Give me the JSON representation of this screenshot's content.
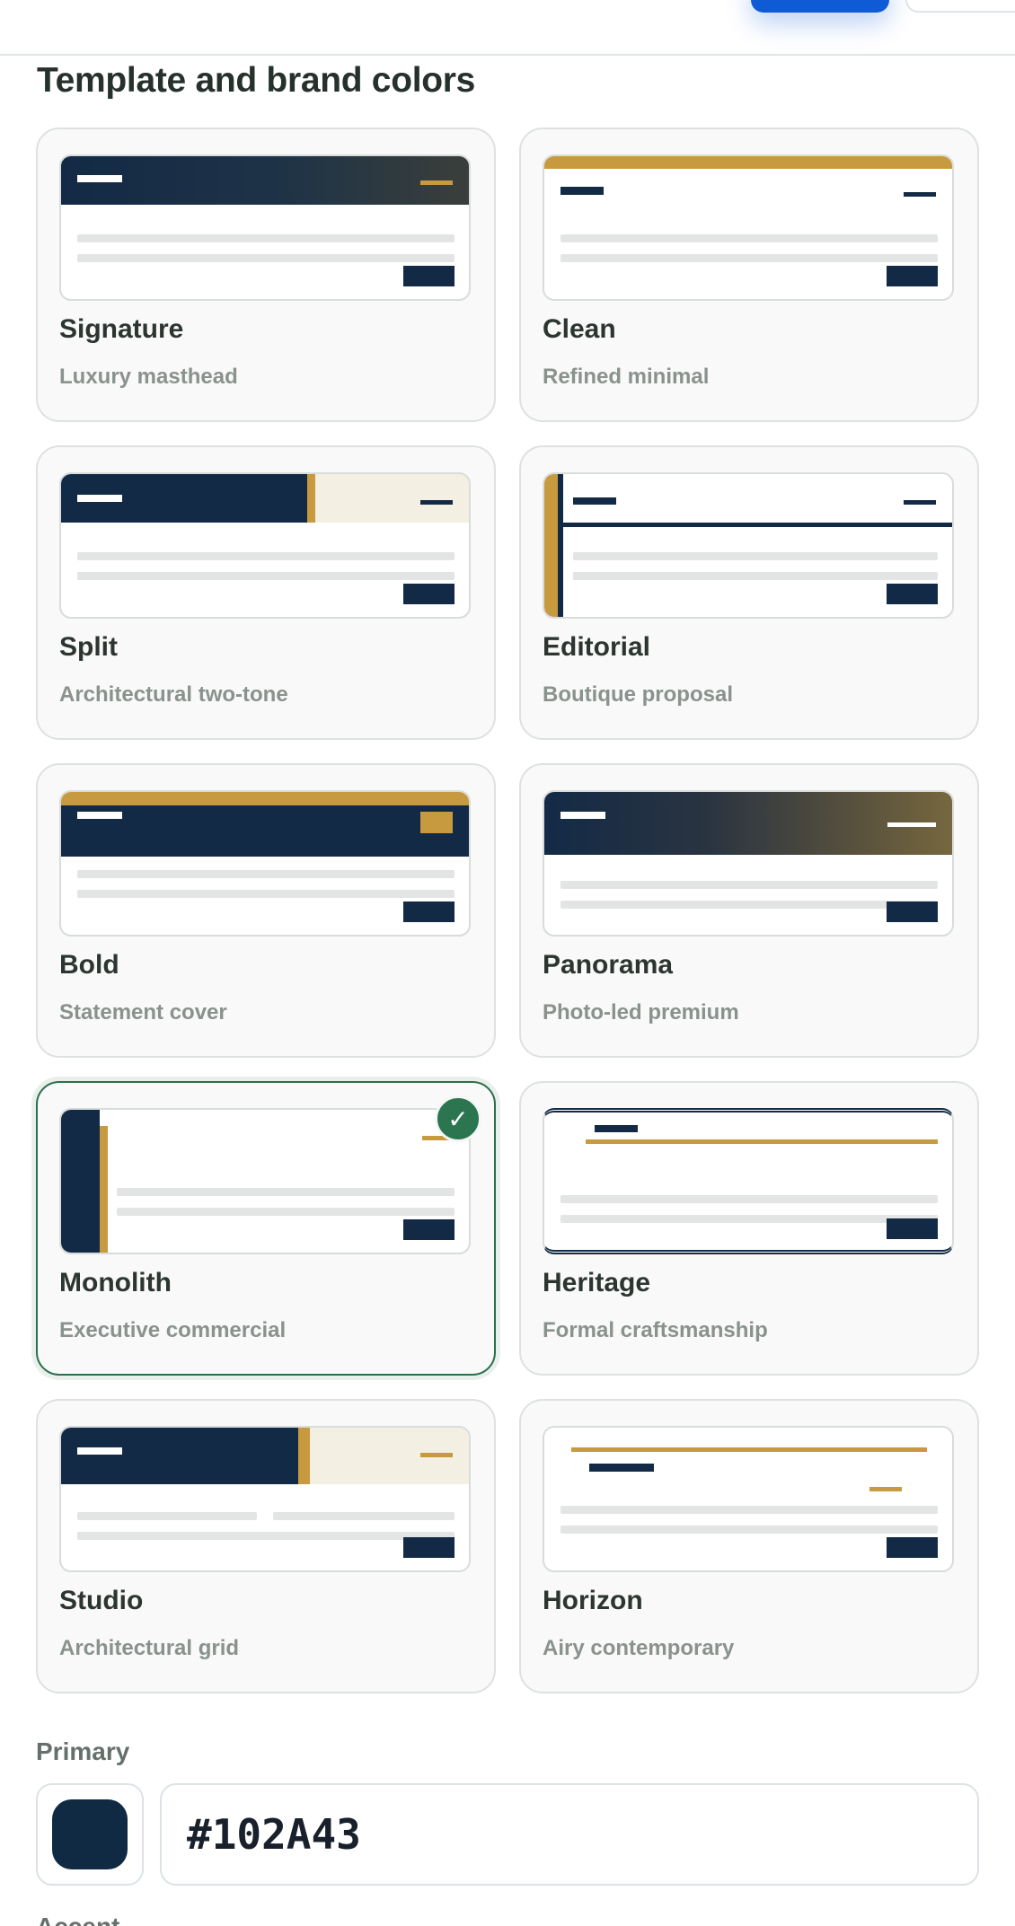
{
  "section": {
    "title": "Template and brand colors"
  },
  "templates": [
    {
      "name": "Signature",
      "desc": "Luxury masthead"
    },
    {
      "name": "Clean",
      "desc": "Refined minimal"
    },
    {
      "name": "Split",
      "desc": "Architectural two-tone"
    },
    {
      "name": "Editorial",
      "desc": "Boutique proposal"
    },
    {
      "name": "Bold",
      "desc": "Statement cover"
    },
    {
      "name": "Panorama",
      "desc": "Photo-led premium"
    },
    {
      "name": "Monolith",
      "desc": "Executive commercial"
    },
    {
      "name": "Heritage",
      "desc": "Formal craftsmanship"
    },
    {
      "name": "Studio",
      "desc": "Architectural grid"
    },
    {
      "name": "Horizon",
      "desc": "Airy contemporary"
    }
  ],
  "selected_template": "Monolith",
  "selected_check_icon": "✓",
  "colors": {
    "primary_label": "Primary",
    "primary_value": "#102A43",
    "next_label": "Accent",
    "navy": "#132A46",
    "gold": "#C89A3F",
    "selected_border": "#2C6F4E"
  }
}
